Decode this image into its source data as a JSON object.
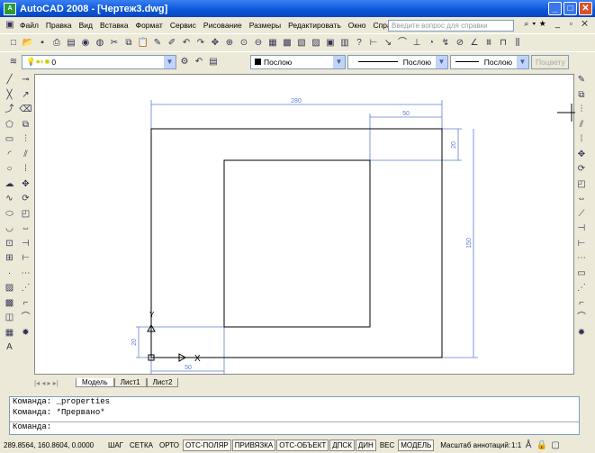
{
  "title": "AutoCAD 2008 - [Чертеж3.dwg]",
  "window_buttons": [
    "minimize",
    "maximize",
    "close"
  ],
  "menu": [
    "Файл",
    "Правка",
    "Вид",
    "Вставка",
    "Формат",
    "Сервис",
    "Рисование",
    "Размеры",
    "Редактировать",
    "Окно",
    "Справка"
  ],
  "help_placeholder": "Введите вопрос для справки",
  "layer": {
    "name": "0"
  },
  "properties": {
    "color": "Послою",
    "linetype": "Послою",
    "lineweight": "Послою",
    "plotstyle": "Поцвету"
  },
  "drawing": {
    "dimensions": [
      "280",
      "50",
      "20",
      "150",
      "20",
      "50"
    ],
    "line_color": "#000000",
    "dim_color": "#5b7fd6",
    "ucs_x": "X",
    "ucs_y": "Y"
  },
  "tabs": [
    "Модель",
    "Лист1",
    "Лист2"
  ],
  "command_history": [
    "Команда:  _properties",
    "Команда:  *Прервано*"
  ],
  "command_prompt": "Команда:",
  "status": {
    "coords": "289.8564, 160.8604, 0.0000",
    "buttons": [
      {
        "label": "ШАГ",
        "on": false
      },
      {
        "label": "СЕТКА",
        "on": false
      },
      {
        "label": "ОРТО",
        "on": false
      },
      {
        "label": "ОТС-ПОЛЯР",
        "on": true
      },
      {
        "label": "ПРИВЯЗКА",
        "on": true
      },
      {
        "label": "ОТС-ОБЪЕКТ",
        "on": true
      },
      {
        "label": "ДПСК",
        "on": true
      },
      {
        "label": "ДИН",
        "on": true
      },
      {
        "label": "ВЕС",
        "on": false
      },
      {
        "label": "МОДЕЛЬ",
        "on": true
      }
    ],
    "annotation_scale_label": "Масштаб аннотаций:",
    "annotation_scale": "1:1"
  }
}
